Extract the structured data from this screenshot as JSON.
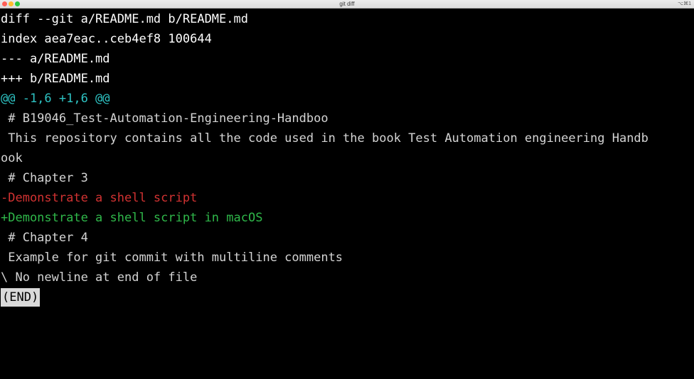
{
  "window": {
    "title": "git diff",
    "shortcut": "⌥⌘1"
  },
  "terminal": {
    "lines": [
      {
        "text": "diff --git a/README.md b/README.md",
        "kind": "meta"
      },
      {
        "text": "index aea7eac..ceb4ef8 100644",
        "kind": "meta"
      },
      {
        "text": "--- a/README.md",
        "kind": "meta"
      },
      {
        "text": "+++ b/README.md",
        "kind": "meta"
      },
      {
        "text": "@@ -1,6 +1,6 @@",
        "kind": "hunk"
      },
      {
        "text": " # B19046_Test-Automation-Engineering-Handboo",
        "kind": "context"
      },
      {
        "text": " This repository contains all the code used in the book Test Automation engineering Handb",
        "kind": "context"
      },
      {
        "text": "ook",
        "kind": "context"
      },
      {
        "text": " # Chapter 3",
        "kind": "context"
      },
      {
        "text": "-Demonstrate a shell script",
        "kind": "removed"
      },
      {
        "text": "+Demonstrate a shell script in macOS",
        "kind": "added"
      },
      {
        "text": " # Chapter 4",
        "kind": "context"
      },
      {
        "text": " Example for git commit with multiline comments",
        "kind": "context"
      },
      {
        "text": "\\ No newline at end of file",
        "kind": "context"
      }
    ],
    "pager_prompt": "(END)"
  },
  "colors": {
    "background": "#000000",
    "meta": "#ffffff",
    "hunk": "#2ec4c4",
    "context": "#d4d4d4",
    "removed": "#d23232",
    "added": "#2fb84a"
  }
}
